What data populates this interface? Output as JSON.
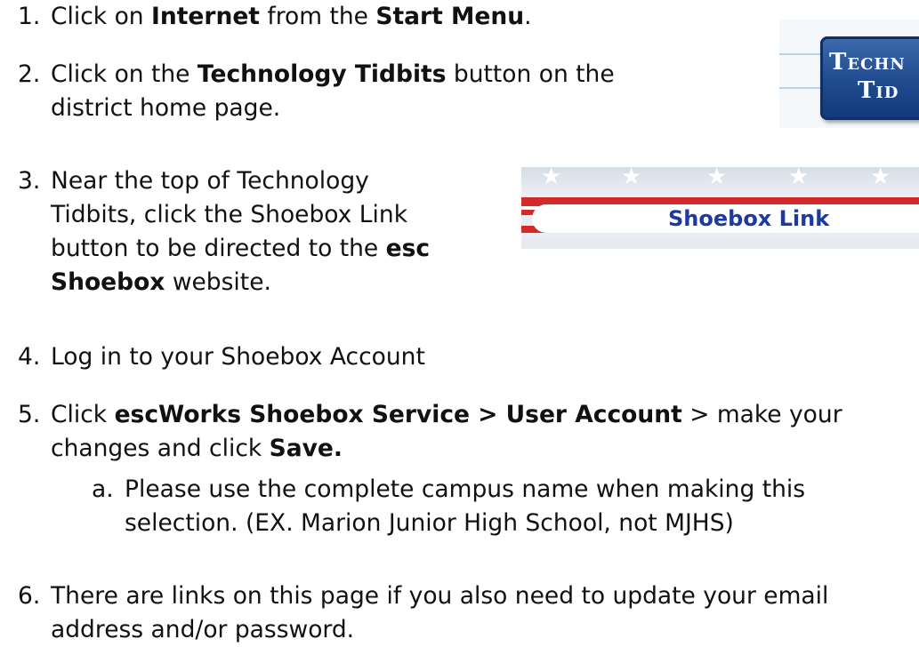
{
  "steps": [
    {
      "num": "1.",
      "lines": [
        [
          {
            "t": "Click on ",
            "b": false
          },
          {
            "t": "Internet",
            "b": true
          },
          {
            "t": " from the ",
            "b": false
          },
          {
            "t": "Start Menu",
            "b": true
          },
          {
            "t": ".",
            "b": false
          }
        ]
      ]
    },
    {
      "num": "2.",
      "lines": [
        [
          {
            "t": "Click on the ",
            "b": false
          },
          {
            "t": "Technology Tidbits",
            "b": true
          },
          {
            "t": " button on the",
            "b": false
          }
        ],
        [
          {
            "t": "district home page.",
            "b": false
          }
        ]
      ]
    },
    {
      "num": "3.",
      "lines": [
        [
          {
            "t": "Near the top of Technology",
            "b": false
          }
        ],
        [
          {
            "t": "Tidbits, click the Shoebox Link",
            "b": false
          }
        ],
        [
          {
            "t": "button to be directed to the ",
            "b": false
          },
          {
            "t": "esc",
            "b": true
          }
        ],
        [
          {
            "t": "Shoebox",
            "b": true
          },
          {
            "t": " website.",
            "b": false
          }
        ]
      ]
    },
    {
      "num": "4.",
      "lines": [
        [
          {
            "t": "Log in to your Shoebox Account",
            "b": false
          }
        ]
      ]
    },
    {
      "num": "5.",
      "lines": [
        [
          {
            "t": "Click ",
            "b": false
          },
          {
            "t": "escWorks Shoebox Service > User Account",
            "b": true
          },
          {
            "t": " > make your",
            "b": false
          }
        ],
        [
          {
            "t": "changes and click ",
            "b": false
          },
          {
            "t": "Save.",
            "b": true
          }
        ]
      ]
    },
    {
      "num": "a.",
      "lines": [
        [
          {
            "t": "Please use the complete campus name when making this",
            "b": false
          }
        ],
        [
          {
            "t": "selection. (EX. Marion Junior High School, not MJHS)",
            "b": false
          }
        ]
      ]
    },
    {
      "num": "6.",
      "lines": [
        [
          {
            "t": "There are links on this page if you also need to update your email",
            "b": false
          }
        ],
        [
          {
            "t": "address and/or password.",
            "b": false
          }
        ]
      ]
    }
  ],
  "tidbits_button": {
    "line1": "Techn",
    "line2": "Tid"
  },
  "shoebox_banner": {
    "label": "Shoebox Link"
  },
  "colors": {
    "text": "#111111",
    "tidbits_button_bg": "#1f4a8e",
    "banner_red": "#d42a2a",
    "banner_label": "#1d3a9c"
  }
}
